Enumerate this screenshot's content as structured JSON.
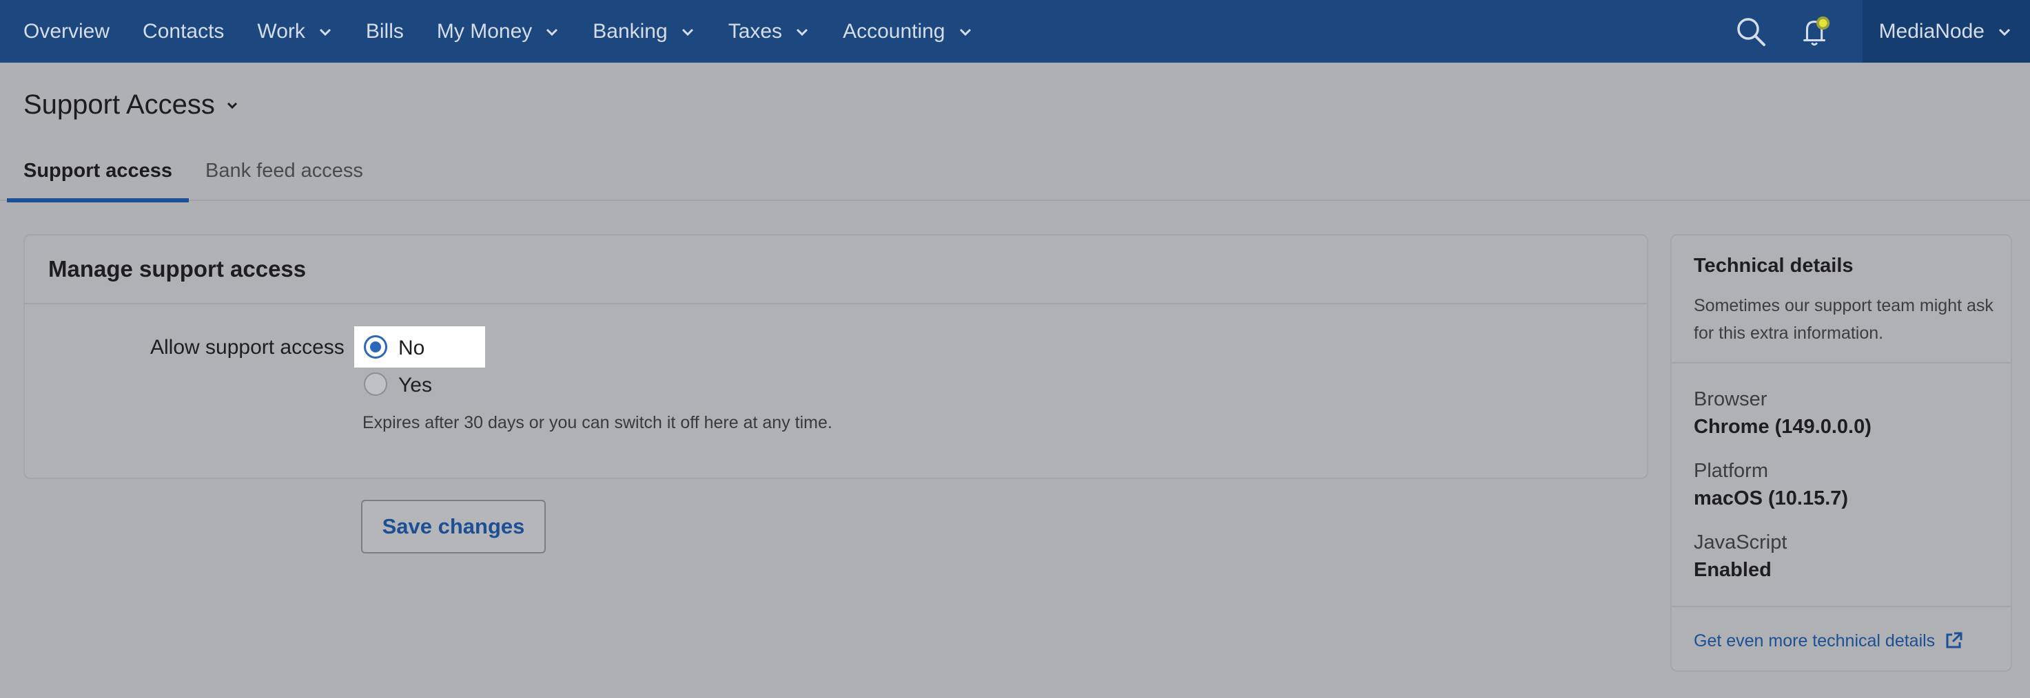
{
  "nav": {
    "items": [
      {
        "label": "Overview",
        "has_chevron": false
      },
      {
        "label": "Contacts",
        "has_chevron": false
      },
      {
        "label": "Work",
        "has_chevron": true
      },
      {
        "label": "Bills",
        "has_chevron": false
      },
      {
        "label": "My Money",
        "has_chevron": true
      },
      {
        "label": "Banking",
        "has_chevron": true
      },
      {
        "label": "Taxes",
        "has_chevron": true
      },
      {
        "label": "Accounting",
        "has_chevron": true
      }
    ],
    "account_name": "MediaNode",
    "colors": {
      "bar": "#1c477f",
      "account": "#163d70",
      "notification_dot": "#d4d23a"
    }
  },
  "page": {
    "title": "Support Access",
    "tabs": [
      {
        "label": "Support access",
        "active": true
      },
      {
        "label": "Bank feed access",
        "active": false
      }
    ]
  },
  "card": {
    "title": "Manage support access",
    "field_label": "Allow support access",
    "options": [
      {
        "label": "No",
        "selected": true
      },
      {
        "label": "Yes",
        "selected": false
      }
    ],
    "hint": "Expires after 30 days or you can switch it off here at any time.",
    "save_label": "Save changes"
  },
  "technical": {
    "title": "Technical details",
    "description": "Sometimes our support team might ask for this extra information.",
    "rows": [
      {
        "label": "Browser",
        "value": "Chrome (149.0.0.0)"
      },
      {
        "label": "Platform",
        "value": "macOS (10.15.7)"
      },
      {
        "label": "JavaScript",
        "value": "Enabled"
      }
    ],
    "link_label": "Get even more technical details"
  }
}
